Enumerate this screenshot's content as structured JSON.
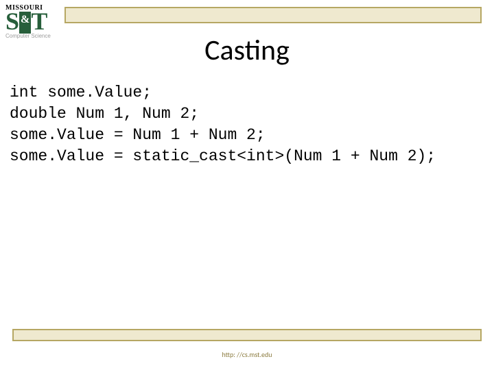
{
  "logo": {
    "top": "MISSOURI",
    "s": "S",
    "amp": "&",
    "t": "T",
    "sub": "Computer Science"
  },
  "title": "Casting",
  "code": {
    "line1": "int some.Value;",
    "line2": "double Num 1, Num 2;",
    "line3": "some.Value = Num 1 + Num 2;",
    "line4": "some.Value = static_cast<int>(Num 1 + Num 2);"
  },
  "footer": "http: //cs.mst.edu"
}
